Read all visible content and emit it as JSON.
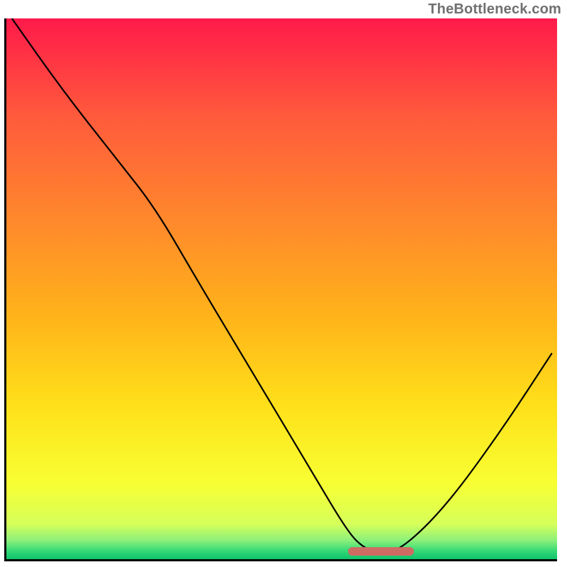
{
  "watermark": "TheBottleneck.com",
  "chart_data": {
    "type": "line",
    "title": "",
    "xlabel": "",
    "ylabel": "",
    "x_unit": "normalized 0–100",
    "y_unit": "normalized 0–100 (0 at bottom)",
    "xlim": [
      0,
      100
    ],
    "ylim": [
      0,
      100
    ],
    "notes": "The V-shaped curve is rendered over a vertical rainbow gradient (green at bottom through yellow and orange to red at top). Axes are shown as black L-shaped frame lines with no tick labels visible.",
    "series": [
      {
        "name": "curve",
        "x": [
          1,
          10,
          20,
          27,
          35,
          45,
          55,
          62,
          65,
          68,
          72,
          80,
          90,
          99
        ],
        "y": [
          100,
          87,
          74,
          65,
          51,
          34,
          17,
          5,
          2,
          1,
          2,
          10,
          24,
          38
        ]
      }
    ],
    "valley_marker": {
      "x_start": 62,
      "x_end": 74,
      "y": 1.5,
      "color": "#ce6b63"
    },
    "gradient_stops": [
      {
        "pos": 0.0,
        "color": "#ff1a4a"
      },
      {
        "pos": 0.18,
        "color": "#ff5a3c"
      },
      {
        "pos": 0.38,
        "color": "#ff8a2b"
      },
      {
        "pos": 0.55,
        "color": "#ffb31a"
      },
      {
        "pos": 0.72,
        "color": "#ffe11a"
      },
      {
        "pos": 0.86,
        "color": "#f7ff33"
      },
      {
        "pos": 0.935,
        "color": "#d6ff5a"
      },
      {
        "pos": 0.965,
        "color": "#8cf07a"
      },
      {
        "pos": 0.985,
        "color": "#33d977"
      },
      {
        "pos": 1.0,
        "color": "#0fc26b"
      }
    ]
  }
}
